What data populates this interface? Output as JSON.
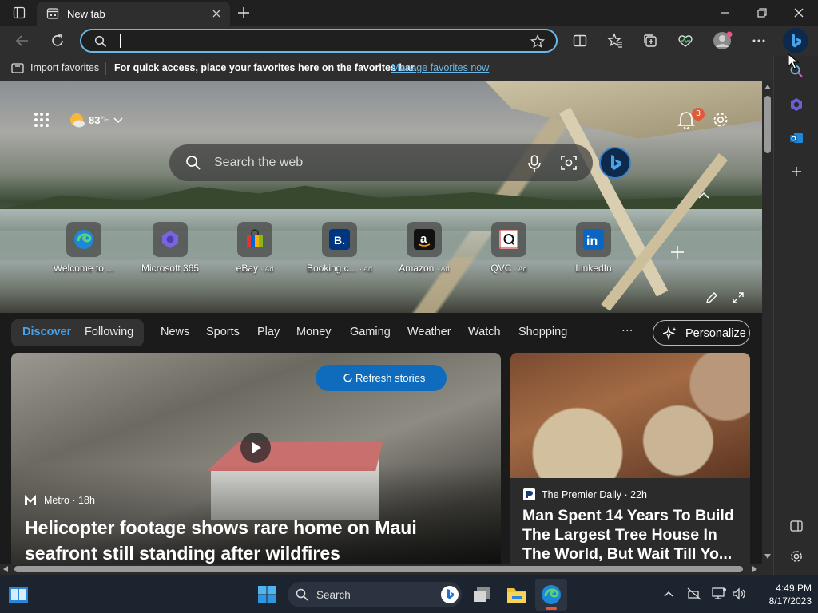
{
  "browser": {
    "tab_title": "New tab",
    "address": {
      "value": "",
      "placeholder": ""
    },
    "favorites_bar": {
      "import_label": "Import favorites",
      "hint_text": "For quick access, place your favorites here on the favorites bar.",
      "manage_link": "Manage favorites now"
    }
  },
  "newtab": {
    "weather": {
      "temp": "83",
      "unit": "°F"
    },
    "notifications_count": "3",
    "search_placeholder": "Search the web",
    "quick_links": [
      {
        "label": "Welcome to ...",
        "ad": ""
      },
      {
        "label": "Microsoft 365",
        "ad": ""
      },
      {
        "label": "eBay",
        "ad": "· Ad"
      },
      {
        "label": "Booking.c...",
        "ad": "· Ad"
      },
      {
        "label": "Amazon",
        "ad": "· Ad"
      },
      {
        "label": "QVC",
        "ad": "· Ad"
      },
      {
        "label": "LinkedIn",
        "ad": ""
      }
    ],
    "nav": {
      "discover": "Discover",
      "following": "Following",
      "items": [
        "News",
        "Sports",
        "Play",
        "Money",
        "Gaming",
        "Weather",
        "Watch",
        "Shopping"
      ],
      "more": "···",
      "personalize": "Personalize"
    },
    "refresh_label": "Refresh stories",
    "cards": [
      {
        "source": "Metro · 18h",
        "headline": "Helicopter footage shows rare home on Maui seafront still standing after wildfires"
      },
      {
        "source": "The Premier Daily · 22h",
        "headline": "Man Spent 14 Years To Build The Largest Tree House In The World, But Wait Till Yo..."
      }
    ]
  },
  "taskbar": {
    "search_label": "Search",
    "time": "4:49 PM",
    "date": "8/17/2023"
  },
  "colors": {
    "accent": "#0f6cbd",
    "link": "#6bb7e8",
    "discover": "#4aa3e8",
    "badge": "#e05a3a"
  }
}
